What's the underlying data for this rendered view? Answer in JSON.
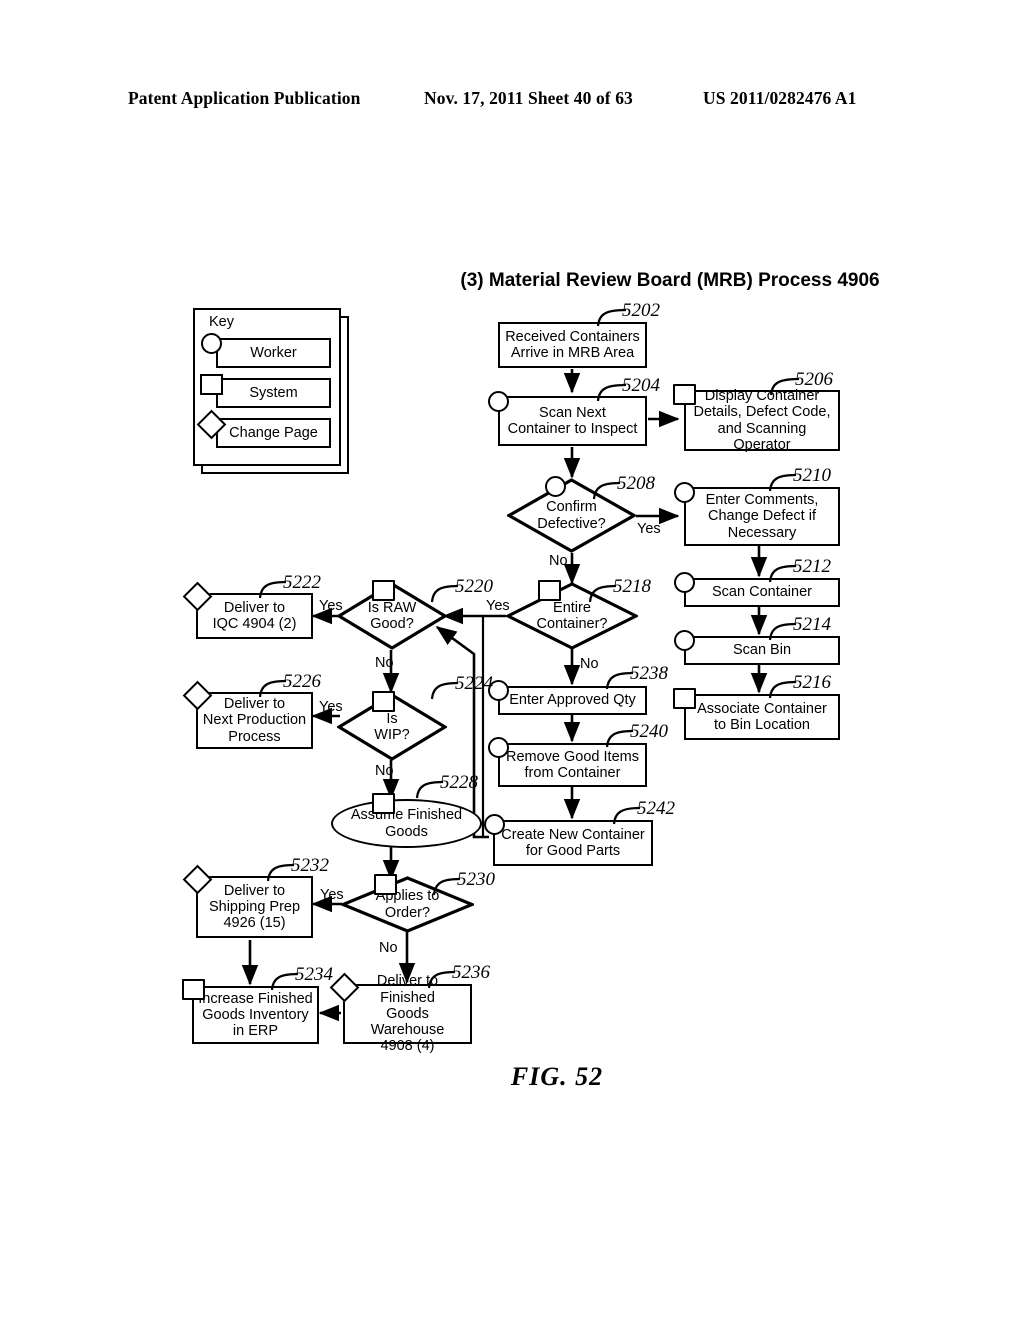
{
  "header": {
    "publication": "Patent Application Publication",
    "date_sheet": "Nov. 17, 2011  Sheet 40 of 63",
    "number": "US 2011/0282476 A1"
  },
  "figure": {
    "title": "(3) Material Review Board (MRB) Process 4906",
    "caption": "FIG. 52"
  },
  "key": {
    "title": "Key",
    "items": [
      {
        "label": "Worker",
        "marker": "circle-marker"
      },
      {
        "label": "System",
        "marker": "square-marker"
      },
      {
        "label": "Change Page",
        "marker": "diamond-marker"
      }
    ]
  },
  "nodes": [
    {
      "id": "5202",
      "ref": "5202",
      "label": "Received Containers\nArrive in MRB Area",
      "shape": "rect",
      "marker": "none"
    },
    {
      "id": "5204",
      "ref": "5204",
      "label": "Scan Next\nContainer to Inspect",
      "shape": "rect",
      "marker": "worker"
    },
    {
      "id": "5206",
      "ref": "5206",
      "label": "Display Container\nDetails, Defect Code,\nand Scanning Operator",
      "shape": "rect",
      "marker": "system"
    },
    {
      "id": "5208",
      "ref": "5208",
      "label": "Confirm\nDefective?",
      "shape": "diamond",
      "marker": "worker"
    },
    {
      "id": "5210",
      "ref": "5210",
      "label": "Enter Comments,\nChange Defect if\nNecessary",
      "shape": "rect",
      "marker": "worker"
    },
    {
      "id": "5212",
      "ref": "5212",
      "label": "Scan Container",
      "shape": "rect",
      "marker": "worker"
    },
    {
      "id": "5214",
      "ref": "5214",
      "label": "Scan Bin",
      "shape": "rect",
      "marker": "worker"
    },
    {
      "id": "5216",
      "ref": "5216",
      "label": "Associate Container\nto Bin Location",
      "shape": "rect",
      "marker": "system"
    },
    {
      "id": "5218",
      "ref": "5218",
      "label": "Entire\nContainer?",
      "shape": "diamond",
      "marker": "system"
    },
    {
      "id": "5220",
      "ref": "5220",
      "label": "Is RAW\nGood?",
      "shape": "diamond",
      "marker": "system"
    },
    {
      "id": "5222",
      "ref": "5222",
      "label": "Deliver to\nIQC 4904 (2)",
      "shape": "rect",
      "marker": "page"
    },
    {
      "id": "5224",
      "ref": "5224",
      "label": "Is\nWIP?",
      "shape": "diamond",
      "marker": "system"
    },
    {
      "id": "5226",
      "ref": "5226",
      "label": "Deliver to\nNext Production\nProcess",
      "shape": "rect",
      "marker": "page"
    },
    {
      "id": "5228",
      "ref": "5228",
      "label": "Assume Finished\nGoods",
      "shape": "ellipse",
      "marker": "system"
    },
    {
      "id": "5230",
      "ref": "5230",
      "label": "Applies to\nOrder?",
      "shape": "diamond",
      "marker": "system"
    },
    {
      "id": "5232",
      "ref": "5232",
      "label": "Deliver to\nShipping Prep\n4926 (15)",
      "shape": "rect",
      "marker": "page"
    },
    {
      "id": "5234",
      "ref": "5234",
      "label": "Increase Finished\nGoods Inventory\nin ERP",
      "shape": "rect",
      "marker": "system"
    },
    {
      "id": "5236",
      "ref": "5236",
      "label": "Deliver to Finished\nGoods Warehouse\n4908 (4)",
      "shape": "rect",
      "marker": "page"
    },
    {
      "id": "5238",
      "ref": "5238",
      "label": "Enter Approved Qty",
      "shape": "rect",
      "marker": "worker"
    },
    {
      "id": "5240",
      "ref": "5240",
      "label": "Remove Good Items\nfrom Container",
      "shape": "rect",
      "marker": "worker"
    },
    {
      "id": "5242",
      "ref": "5242",
      "label": "Create New Container\nfor Good Parts",
      "shape": "rect",
      "marker": "worker"
    }
  ],
  "branch_labels": [
    {
      "id": "b5208yes",
      "text": "Yes"
    },
    {
      "id": "b5208no",
      "text": "No"
    },
    {
      "id": "b5218yes",
      "text": "Yes"
    },
    {
      "id": "b5218no",
      "text": "No"
    },
    {
      "id": "b5220yes",
      "text": "Yes"
    },
    {
      "id": "b5220no",
      "text": "No"
    },
    {
      "id": "b5224yes",
      "text": "Yes"
    },
    {
      "id": "b5224no",
      "text": "No"
    },
    {
      "id": "b5230yes",
      "text": "Yes"
    },
    {
      "id": "b5230no",
      "text": "No"
    }
  ]
}
